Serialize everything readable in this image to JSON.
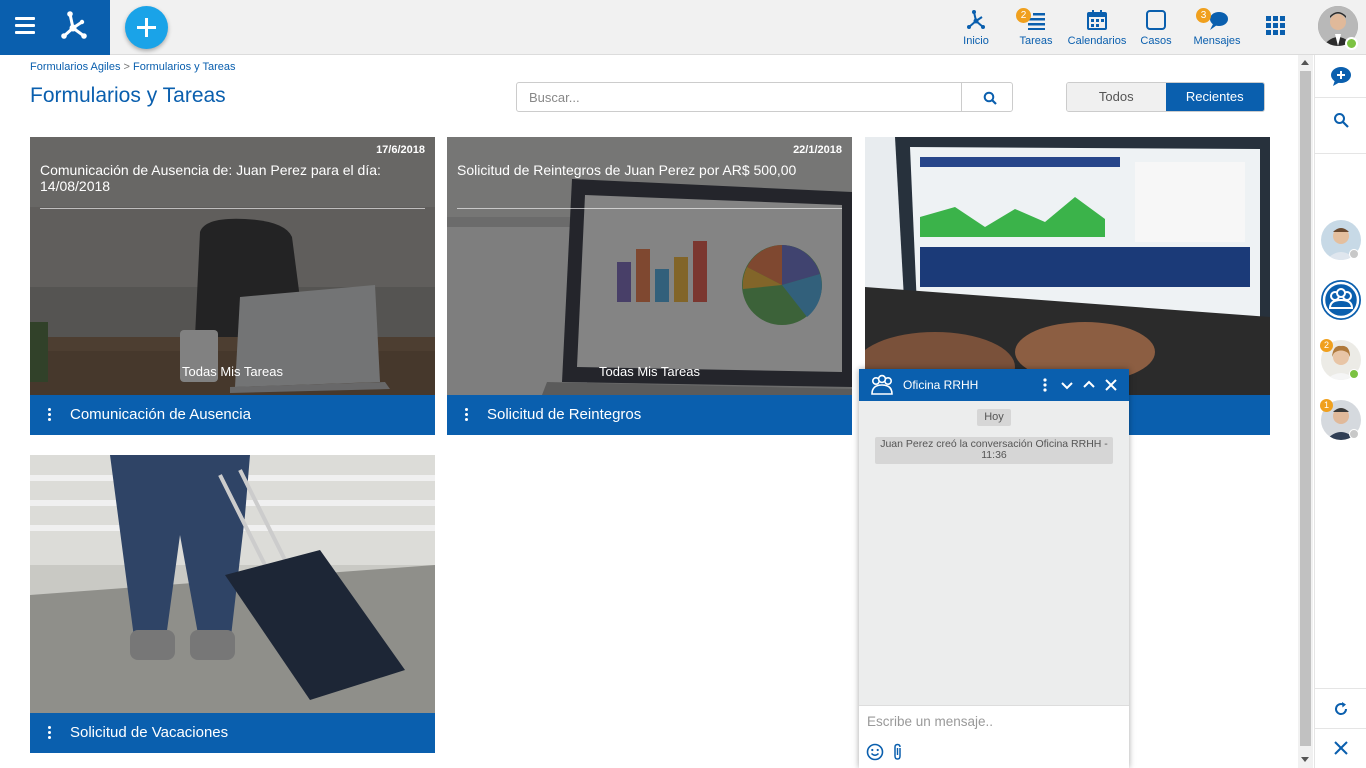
{
  "header": {
    "nav": [
      {
        "label": "Inicio",
        "icon": "home-network-icon",
        "badge": null
      },
      {
        "label": "Tareas",
        "icon": "tasks-icon",
        "badge": "2"
      },
      {
        "label": "Calendarios",
        "icon": "calendar-icon",
        "badge": null
      },
      {
        "label": "Casos",
        "icon": "cases-icon",
        "badge": null
      },
      {
        "label": "Mensajes",
        "icon": "messages-icon",
        "badge": "3"
      }
    ],
    "accent_color": "#0a5fae",
    "add_button_color": "#1aa3e8",
    "badge_color": "#f0a01e"
  },
  "breadcrumb": [
    "Formularios Agiles",
    "Formularios y Tareas"
  ],
  "breadcrumb_separator": ">",
  "page": {
    "title": "Formularios y Tareas"
  },
  "search": {
    "placeholder": "Buscar...",
    "value": ""
  },
  "filter": {
    "todos": "Todos",
    "recientes": "Recientes",
    "selected": "Recientes"
  },
  "cards": [
    {
      "title": "Comunicación de Ausencia",
      "date": "17/6/2018",
      "description": "Comunicación de Ausencia de: Juan Perez para el día: 14/08/2018",
      "subtitle": "Todas Mis Tareas"
    },
    {
      "title": "Solicitud de Reintegros",
      "date": "22/1/2018",
      "description": "Solicitud de Reintegros de Juan  Perez por  AR$  500,00",
      "subtitle": "Todas Mis Tareas"
    },
    {
      "title": "",
      "date": "",
      "description": "",
      "subtitle": ""
    },
    {
      "title": "Solicitud de Vacaciones",
      "date": "",
      "description": "",
      "subtitle": ""
    }
  ],
  "rail": {
    "contacts": [
      {
        "name": "contact-1",
        "status": "offline",
        "badge": null
      },
      {
        "name": "group-rrhh",
        "status": null,
        "badge": null
      },
      {
        "name": "contact-2",
        "status": "online",
        "badge": "2"
      },
      {
        "name": "contact-3",
        "status": "offline",
        "badge": "1"
      }
    ]
  },
  "chat": {
    "title": "Oficina RRHH",
    "day_label": "Hoy",
    "system_message": "Juan Perez creó la conversación Oficina RRHH - 11:36",
    "input_placeholder": "Escribe un mensaje.."
  }
}
